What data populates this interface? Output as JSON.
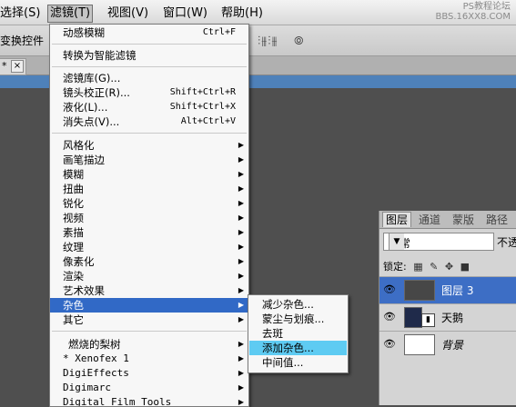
{
  "menubar": {
    "items": [
      "选择(S)",
      "滤镜(T)",
      "视图(V)",
      "窗口(W)",
      "帮助(H)"
    ],
    "watermark_line1": "PS教程论坛",
    "watermark_line2": "BBS.16XX8.COM"
  },
  "options_bar": {
    "label": "变换控件"
  },
  "document_tab": {
    "marker": "*",
    "close": "×"
  },
  "filter_menu": {
    "last_filter": {
      "label": "动感模糊",
      "shortcut": "Ctrl+F"
    },
    "smart_filter": "转换为智能滤镜",
    "gallery": "滤镜库(G)...",
    "lens_correction": {
      "label": "镜头校正(R)...",
      "shortcut": "Shift+Ctrl+R"
    },
    "liquify": {
      "label": "液化(L)...",
      "shortcut": "Shift+Ctrl+X"
    },
    "vanishing_point": {
      "label": "消失点(V)...",
      "shortcut": "Alt+Ctrl+V"
    },
    "groups": [
      "风格化",
      "画笔描边",
      "模糊",
      "扭曲",
      "锐化",
      "视频",
      "素描",
      "纹理",
      "像素化",
      "渲染",
      "艺术效果",
      "杂色",
      "其它"
    ],
    "highlighted": "杂色",
    "plugins": [
      "燃烧的梨树",
      "* Xenofex 1",
      "DigiEffects",
      "Digimarc",
      "Digital Film Tools"
    ]
  },
  "noise_submenu": {
    "items": [
      "减少杂色...",
      "蒙尘与划痕...",
      "去斑",
      "添加杂色...",
      "中间值..."
    ],
    "highlighted": "添加杂色..."
  },
  "layers_panel": {
    "tabs": [
      "图层",
      "通道",
      "蒙版",
      "路径"
    ],
    "blend_mode": "正常",
    "opacity_label": "不透",
    "lock_label": "锁定:",
    "layers": [
      {
        "name": "图层 3",
        "selected": true
      },
      {
        "name": "天鹅",
        "selected": false
      },
      {
        "name": "背景",
        "selected": false
      }
    ]
  },
  "colors": {
    "menu_highlight": "#3169c6",
    "submenu_highlight": "#5ecbf2",
    "layer_selected": "#3d6ec5",
    "workspace": "#4f4f4f"
  }
}
